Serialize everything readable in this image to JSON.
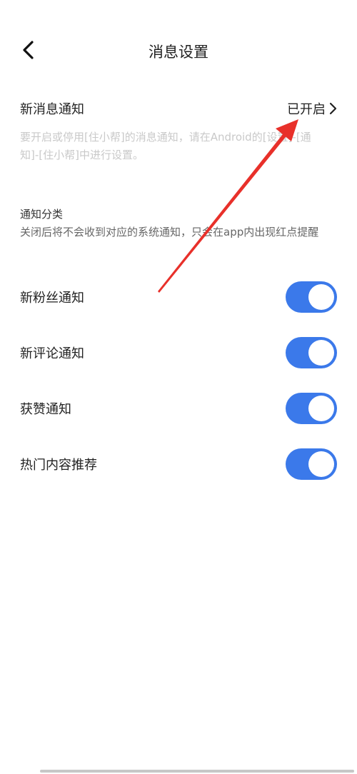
{
  "header": {
    "title": "消息设置"
  },
  "new_message": {
    "label": "新消息通知",
    "status": "已开启",
    "hint": "要开启或停用[住小帮]的消息通知，请在Android的[设置]-[通知]-[住小帮]中进行设置。"
  },
  "categories": {
    "title": "通知分类",
    "description": "关闭后将不会收到对应的系统通知，只会在app内出现红点提醒",
    "items": [
      {
        "label": "新粉丝通知",
        "enabled": true
      },
      {
        "label": "新评论通知",
        "enabled": true
      },
      {
        "label": "获赞通知",
        "enabled": true
      },
      {
        "label": "热门内容推荐",
        "enabled": true
      }
    ]
  },
  "colors": {
    "toggle_on": "#3b79ea",
    "annotation_arrow": "#e8302a"
  },
  "icons": {
    "back": "chevron-left-icon",
    "status_arrow": "chevron-right-icon"
  }
}
